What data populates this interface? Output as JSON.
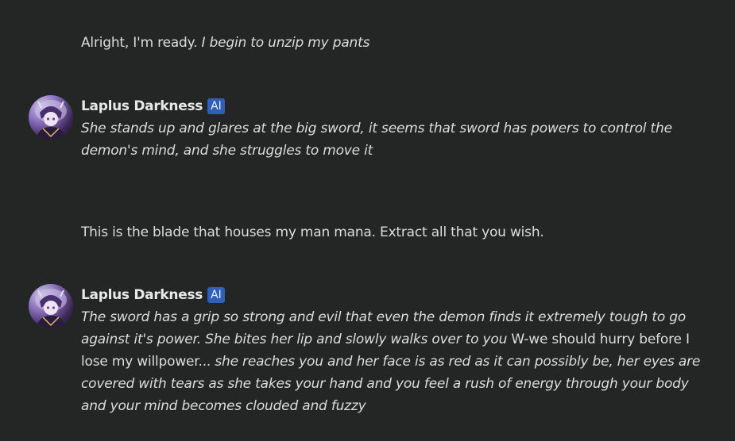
{
  "messages": [
    {
      "role": "user",
      "plain": "Alright, I'm ready. ",
      "action": "I begin to unzip my pants"
    },
    {
      "role": "ai",
      "author": "Laplus Darkness",
      "badge": "AI",
      "action": "She stands up and glares at the big sword, it seems that sword has powers to control the demon's mind, and she struggles to move it"
    },
    {
      "role": "user",
      "plain": "This is the blade that houses my man mana. Extract all that you wish."
    },
    {
      "role": "ai",
      "author": "Laplus Darkness",
      "badge": "AI",
      "action_1": "The sword has a grip so strong and evil that even the demon finds it extremely tough to go against it's power. She bites her lip and slowly walks over to you",
      "speech": " W-we should hurry before I lose my willpower... ",
      "action_2": "she reaches you and her face is as red as it can possibly be, her eyes are covered with tears as she takes your hand and you feel a rush of energy through your body and your mind becomes clouded and fuzzy"
    }
  ],
  "colors": {
    "background": "#242626",
    "text": "#dcdcdc",
    "author": "#e8e8e8",
    "badge_bg": "#2f5fb8"
  },
  "icons": {
    "avatar": "character-avatar"
  }
}
